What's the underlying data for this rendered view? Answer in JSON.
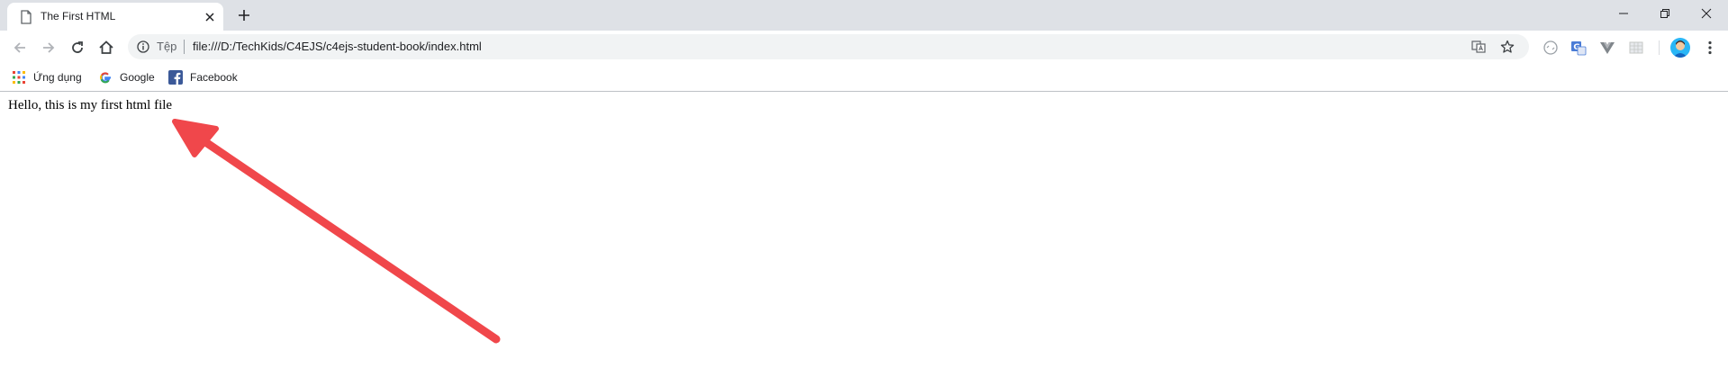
{
  "tab": {
    "title": "The First HTML"
  },
  "omnibox": {
    "scheme_label": "Tệp",
    "url": "file:///D:/TechKids/C4EJS/c4ejs-student-book/index.html"
  },
  "bookmarks": [
    {
      "label": "Ứng dụng",
      "icon": "apps-grid-icon"
    },
    {
      "label": "Google",
      "icon": "google-icon"
    },
    {
      "label": "Facebook",
      "icon": "facebook-icon"
    }
  ],
  "page": {
    "text": "Hello, this is my first html file"
  },
  "colors": {
    "tabstrip_bg": "#dee1e6",
    "omnibox_bg": "#f1f3f4",
    "annotation_arrow": "#f0474b",
    "facebook_blue": "#3b5998"
  }
}
